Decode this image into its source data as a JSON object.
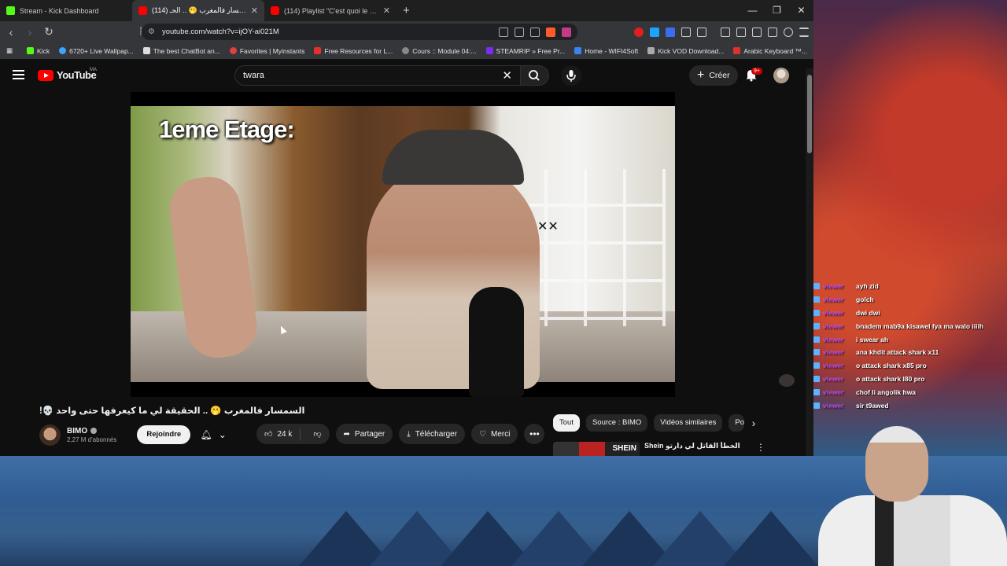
{
  "tabs": [
    {
      "title": "Stream - Kick Dashboard",
      "color": "#53fc18"
    },
    {
      "title": "(114) السمسار فالمغرب 🫢 .. الحـ",
      "color": "#ff0000"
    },
    {
      "title": "(114) Playlist \"C'est quoi le titre de",
      "color": "#ff0000"
    }
  ],
  "address": {
    "url": "youtube.com/watch?v=ijOY-ai021M"
  },
  "bookmarks": [
    {
      "label": "Kick",
      "color": "#53fc18"
    },
    {
      "label": "6720+ Live Wallpap...",
      "color": "#3ba4ff"
    },
    {
      "label": "The best ChatBot an...",
      "color": "#dddddd"
    },
    {
      "label": "Favorites | Myinstants",
      "color": "#e04040"
    },
    {
      "label": "Free Resources for L...",
      "color": "#e03030"
    },
    {
      "label": "Cours :: Module 04:...",
      "color": "#888888"
    },
    {
      "label": "STEAMRIP » Free Pr...",
      "color": "#7b2cf0"
    },
    {
      "label": "Home - WIFI4Soft",
      "color": "#3b82f6"
    },
    {
      "label": "Kick VOD Download...",
      "color": "#aaaaaa"
    },
    {
      "label": "Arabic Keyboard ™...",
      "color": "#e03030"
    }
  ],
  "yt": {
    "brand": "YouTube",
    "country": "MA",
    "search_value": "twara",
    "create_label": "Créer",
    "notif_count": "9+"
  },
  "video": {
    "overlay_text": "1eme Etage:",
    "overlay_x": "✕✕",
    "title": "السمسار فالمغرب 🫢 .. الحقيقة لي ما كيعرفها حتى واحد 💀!"
  },
  "channel": {
    "name": "BIMO",
    "subscribers": "2,27 M d'abonnés",
    "join_label": "Rejoindre"
  },
  "actions": {
    "likes": "24 k",
    "share": "Partager",
    "download": "Télécharger",
    "thanks": "Merci"
  },
  "chips": [
    "Tout",
    "Source : BIMO",
    "Vidéos similaires",
    "Po"
  ],
  "recommendation": {
    "thumb_text": "SHEIN",
    "title": "Shein الخطأ القاتل لي دارتو"
  },
  "chat": [
    {
      "name": "viewer",
      "text": "ayh zid"
    },
    {
      "name": "viewer",
      "text": "golch"
    },
    {
      "name": "viewer",
      "text": "dwi dwi"
    },
    {
      "name": "viewer",
      "text": "bnadem mab9a kisawel fya ma walo iiiih"
    },
    {
      "name": "viewer",
      "text": "i swear ah"
    },
    {
      "name": "viewer",
      "text": "ana khdit attack shark x11"
    },
    {
      "name": "viewer",
      "text": "o attack shark x85 pro"
    },
    {
      "name": "viewer",
      "text": "o attack shark l80 pro"
    },
    {
      "name": "viewer",
      "text": "chof li angolik hwa"
    },
    {
      "name": "viewer",
      "text": "sir t9awed"
    }
  ]
}
